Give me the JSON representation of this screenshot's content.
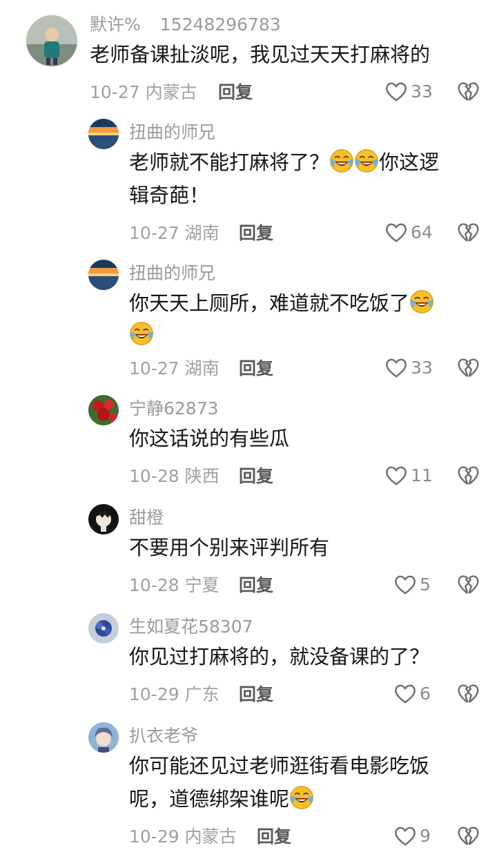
{
  "colors": {
    "text": "#161616",
    "muted": "#9a9a9a",
    "action": "#5a5a5a",
    "icon": "#6e6e6e"
  },
  "comments": [
    {
      "username": "默许%",
      "user_id": "15248296783",
      "lines": [
        "老师备课扯淡呢，我见过天天打麻将的"
      ],
      "date": "10-27",
      "location": "内蒙古",
      "reply_label": "回复",
      "likes": "33",
      "avatar_icon": "child-photo-avatar"
    },
    {
      "username": "扭曲的师兄",
      "lines": [
        "老师就不能打麻将了？",
        "你这逻",
        "辑奇葩！"
      ],
      "emoji": "face-with-tears-of-joy-icon",
      "date": "10-27",
      "location": "湖南",
      "reply_label": "回复",
      "likes": "64",
      "avatar_icon": "sunset-lake-avatar"
    },
    {
      "username": "扭曲的师兄",
      "lines": [
        "你天天上厕所，难道就不吃饭了"
      ],
      "date": "10-27",
      "location": "湖南",
      "reply_label": "回复",
      "likes": "33",
      "avatar_icon": "sunset-lake-avatar"
    },
    {
      "username": "宁静62873",
      "lines": [
        "你这话说的有些瓜"
      ],
      "date": "10-28",
      "location": "陕西",
      "reply_label": "回复",
      "likes": "11",
      "avatar_icon": "red-flowers-avatar"
    },
    {
      "username": "甜橙",
      "lines": [
        "不要用个别来评判所有"
      ],
      "date": "10-28",
      "location": "宁夏",
      "reply_label": "回复",
      "likes": "5",
      "avatar_icon": "anime-character-avatar"
    },
    {
      "username": "生如夏花58307",
      "lines": [
        "你见过打麻将的，就没备课的了？"
      ],
      "date": "10-29",
      "location": "广东",
      "reply_label": "回复",
      "likes": "6",
      "avatar_icon": "blue-flower-avatar"
    },
    {
      "username": "扒衣老爷",
      "lines": [
        "你可能还见过老师逛街看电影吃饭",
        "呢，道德绑架谁呢"
      ],
      "date": "10-29",
      "location": "内蒙古",
      "reply_label": "回复",
      "likes": "9",
      "avatar_icon": "anime-boy-avatar"
    }
  ]
}
